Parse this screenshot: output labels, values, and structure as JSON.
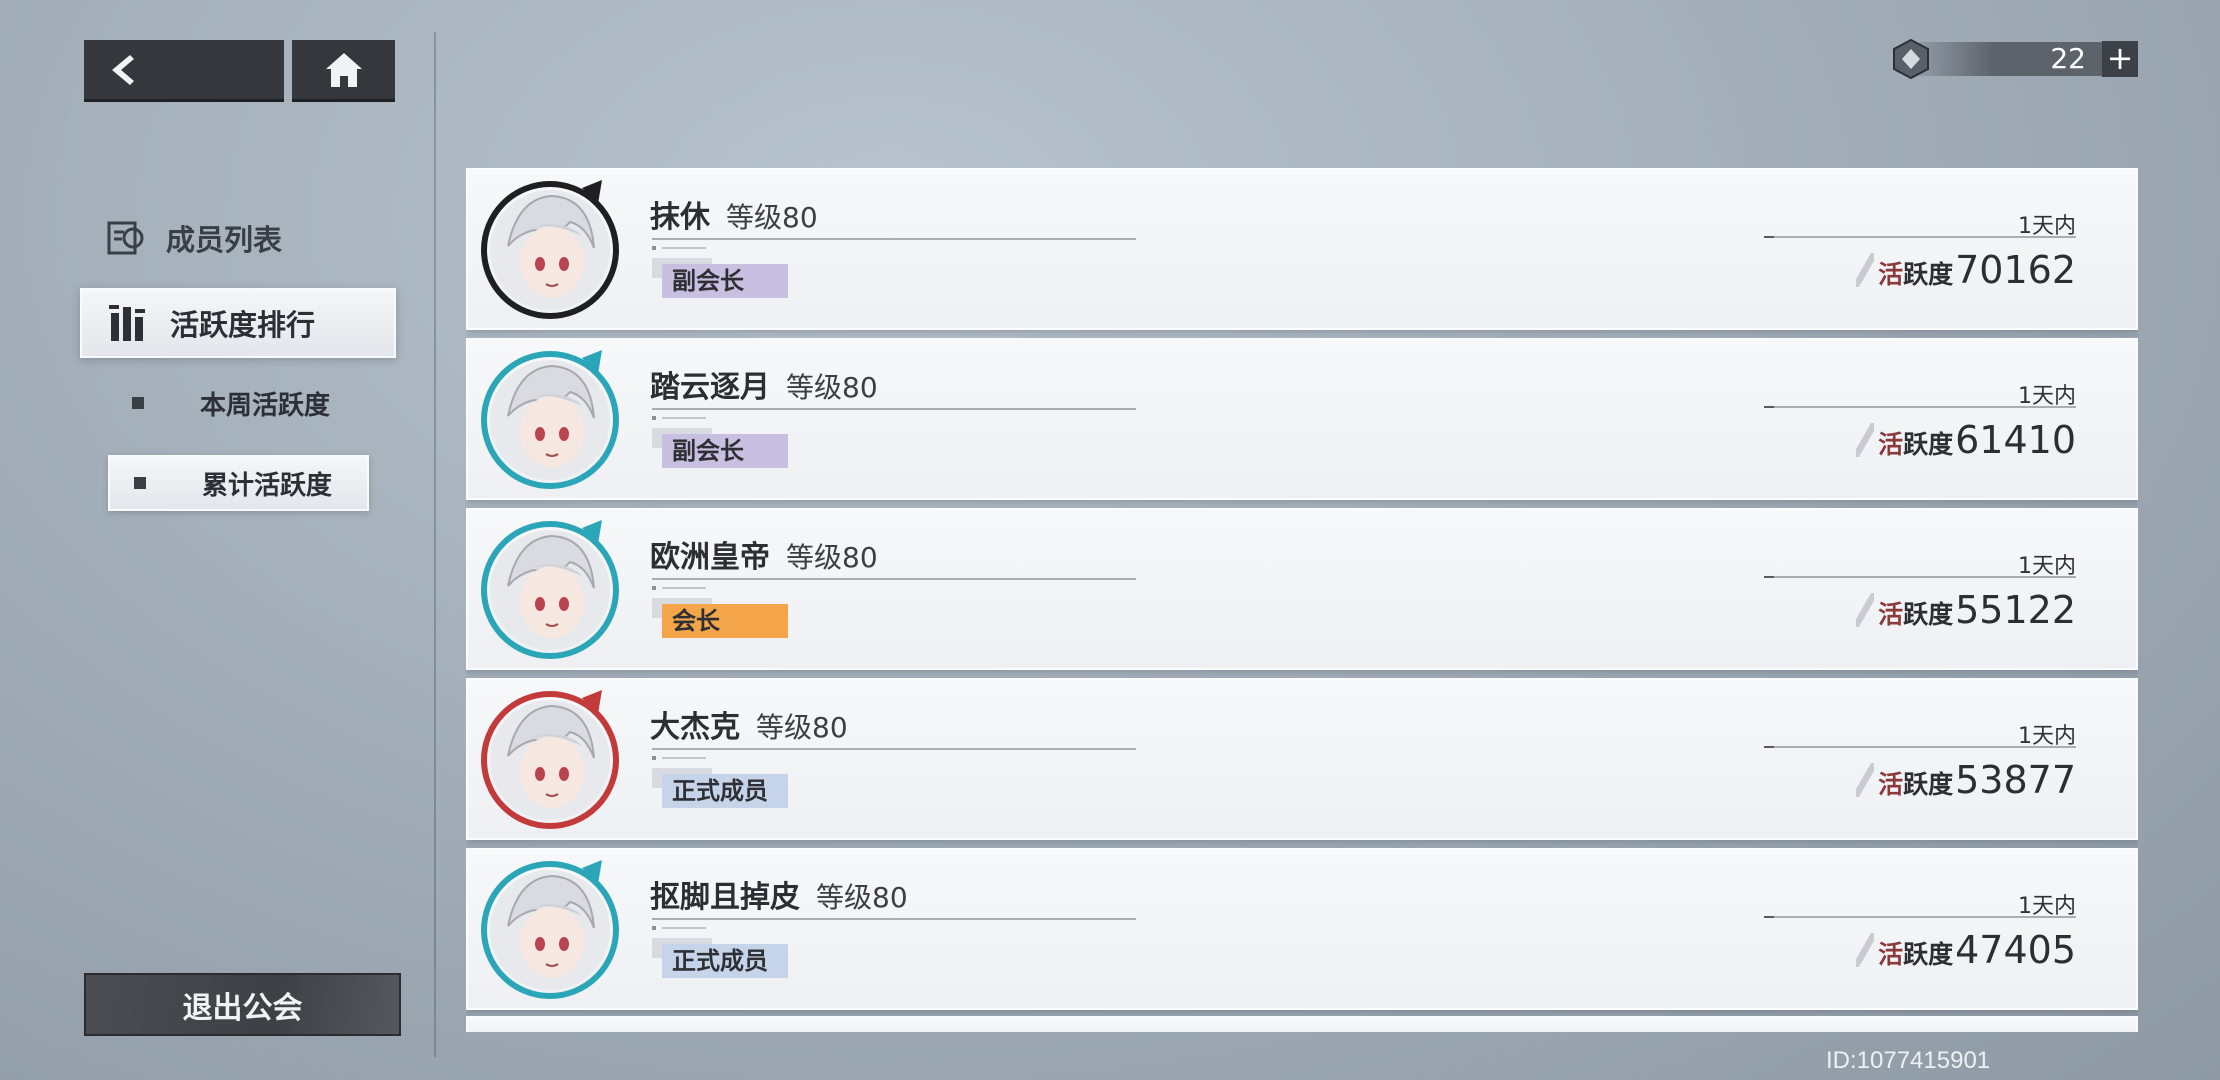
{
  "nav": {
    "back_icon": "back-arrow-icon",
    "home_icon": "home-icon"
  },
  "currency": {
    "icon": "ticket-icon",
    "value": "22",
    "plus_label": "+"
  },
  "sidebar": {
    "members_label": "成员列表",
    "members_icon": "members-icon",
    "activity_label": "活跃度排行",
    "activity_icon": "ranking-icon",
    "sub_items": [
      {
        "label": "本周活跃度",
        "selected": false
      },
      {
        "label": "累计活跃度",
        "selected": true
      }
    ],
    "leave_label": "退出公会"
  },
  "members": [
    {
      "name": "抹休",
      "level": "等级80",
      "role": "副会长",
      "role_color": "#c9bfe0",
      "time": "1天内",
      "activity_label": "活跃度",
      "activity": "70162",
      "frame_color": "#1f1f22"
    },
    {
      "name": "踏云逐月",
      "level": "等级80",
      "role": "副会长",
      "role_color": "#c9bfe0",
      "time": "1天内",
      "activity_label": "活跃度",
      "activity": "61410",
      "frame_color": "#2aa6b8"
    },
    {
      "name": "欧洲皇帝",
      "level": "等级80",
      "role": "会长",
      "role_color": "#f4a54a",
      "time": "1天内",
      "activity_label": "活跃度",
      "activity": "55122",
      "frame_color": "#2aa6b8"
    },
    {
      "name": "大杰克",
      "level": "等级80",
      "role": "正式成员",
      "role_color": "#c6d4ea",
      "time": "1天内",
      "activity_label": "活跃度",
      "activity": "53877",
      "frame_color": "#c23a3a"
    },
    {
      "name": "抠脚且掉皮",
      "level": "等级80",
      "role": "正式成员",
      "role_color": "#c6d4ea",
      "time": "1天内",
      "activity_label": "活跃度",
      "activity": "47405",
      "frame_color": "#2aa6b8"
    }
  ],
  "footer": {
    "player_id": "ID:1077415901"
  }
}
